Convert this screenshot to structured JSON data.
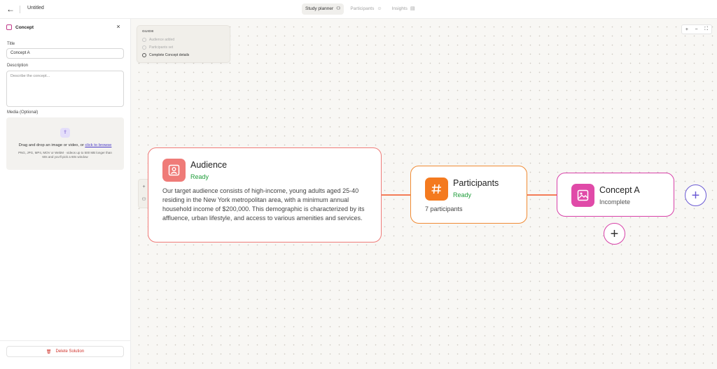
{
  "topbar": {
    "back_icon": "arrow-left-icon",
    "doc_title": "Untitled",
    "tabs": [
      {
        "label": "Study planner",
        "icon": "flow-icon",
        "active": true
      },
      {
        "label": "Participants",
        "icon": "people-icon",
        "active": false
      },
      {
        "label": "Insights",
        "icon": "chart-icon",
        "active": false
      }
    ]
  },
  "sidebar": {
    "title": "Concept",
    "title_label": "Title",
    "title_value": "Concept A",
    "description_label": "Description",
    "description_placeholder": "Describe the concept...",
    "media_label": "Media (Optional)",
    "dropzone_text": "Drag and drop an image or video, or",
    "dropzone_link": "click to browse",
    "dropzone_sub": "PNG, JPG, MP4, MOV or WebM · videos up to 500 MB longer than 60s and you'll pick a 60s window",
    "delete_label": "Delete Solution"
  },
  "guide": {
    "title": "GUIDE",
    "items": [
      {
        "label": "Audience added",
        "state": "done"
      },
      {
        "label": "Participants set",
        "state": "done"
      },
      {
        "label": "Complete Concept details",
        "state": "current"
      }
    ]
  },
  "zoom": {
    "in": "+",
    "out": "−",
    "fit": "⛶"
  },
  "nodes": {
    "audience": {
      "title": "Audience",
      "status": "Ready",
      "description": "Our target audience consists of high-income, young adults aged 25-40 residing in the New York metropolitan area, with a minimum annual household income of $200,000. This demographic is characterized by its affluence, urban lifestyle, and access to various amenities and services.",
      "icon": "user-card-icon",
      "color": "#ef7b78"
    },
    "participants": {
      "title": "Participants",
      "status": "Ready",
      "count": "7 participants",
      "icon": "hash-icon",
      "color": "#f47a1f"
    },
    "concept": {
      "title": "Concept A",
      "status": "Incomplete",
      "icon": "image-icon",
      "color": "#e04aa8"
    }
  },
  "colors": {
    "ready": "#1f9d3a",
    "incomplete": "#555555",
    "edge": "#f47c57",
    "delete": "#d0342c"
  }
}
